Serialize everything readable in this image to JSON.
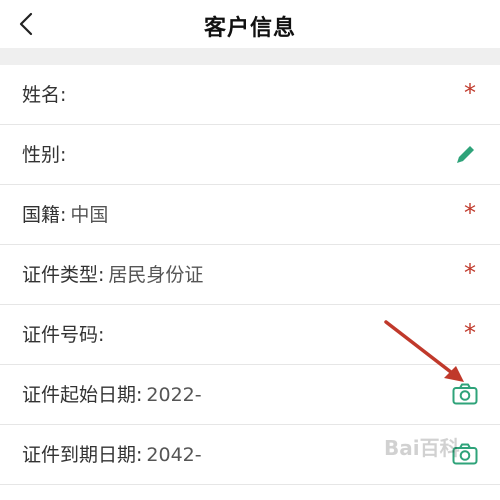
{
  "header": {
    "title": "客户信息"
  },
  "rows": [
    {
      "label": "姓名:",
      "value": ""
    },
    {
      "label": "性别:",
      "value": ""
    },
    {
      "label": "国籍:",
      "value": "中国"
    },
    {
      "label": "证件类型:",
      "value": "居民身份证"
    },
    {
      "label": "证件号码:",
      "value": ""
    },
    {
      "label": "证件起始日期:",
      "value": "2022-"
    },
    {
      "label": "证件到期日期:",
      "value": "2042-"
    }
  ],
  "required_mark": "*",
  "watermark": "Bai百科",
  "colors": {
    "accent": "#2fa37a",
    "required": "#c0392b",
    "arrow": "#c0392b"
  },
  "icons": [
    "back-chevron-icon",
    "pencil-icon",
    "camera-icon"
  ]
}
